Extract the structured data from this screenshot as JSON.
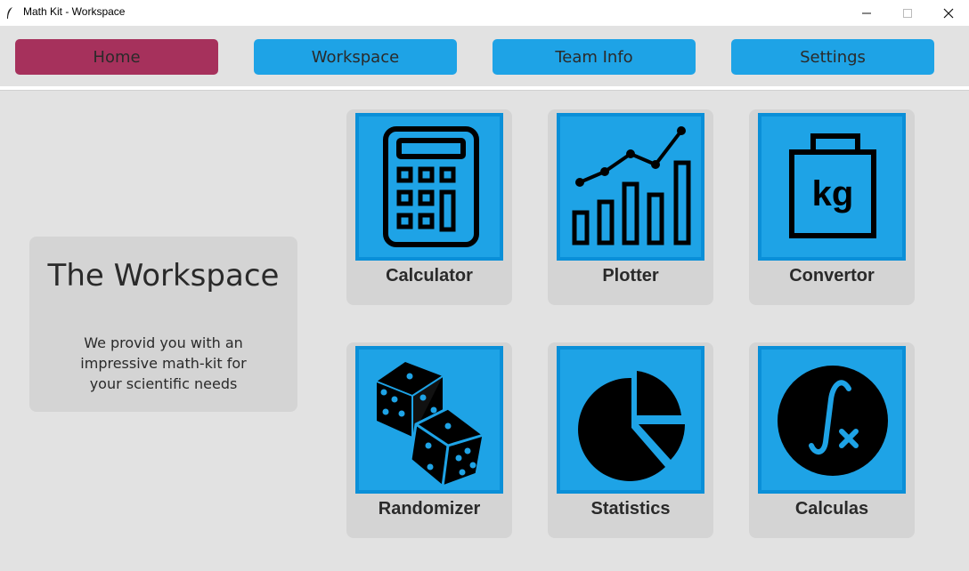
{
  "window": {
    "title": "Math Kit - Workspace",
    "controls": {
      "minimize": "–",
      "maximize": "☐",
      "close": "✕"
    }
  },
  "nav": {
    "items": [
      {
        "label": "Home",
        "active": true
      },
      {
        "label": "Workspace",
        "active": false
      },
      {
        "label": "Team Info",
        "active": false
      },
      {
        "label": "Settings",
        "active": false
      }
    ]
  },
  "info": {
    "title": "The Workspace",
    "description": "We provid you with an\nimpressive math-kit for\nyour scientific needs"
  },
  "tools": [
    {
      "label": "Calculator",
      "icon": "calculator-icon"
    },
    {
      "label": "Plotter",
      "icon": "chart-icon"
    },
    {
      "label": "Convertor",
      "icon": "weight-kg-icon"
    },
    {
      "label": "Randomizer",
      "icon": "dice-icon"
    },
    {
      "label": "Statistics",
      "icon": "pie-chart-icon"
    },
    {
      "label": "Calculas",
      "icon": "integral-icon"
    }
  ],
  "colors": {
    "tile_blue": "#1ea3e6",
    "active_nav": "#a6315c",
    "background": "#e2e2e2"
  }
}
